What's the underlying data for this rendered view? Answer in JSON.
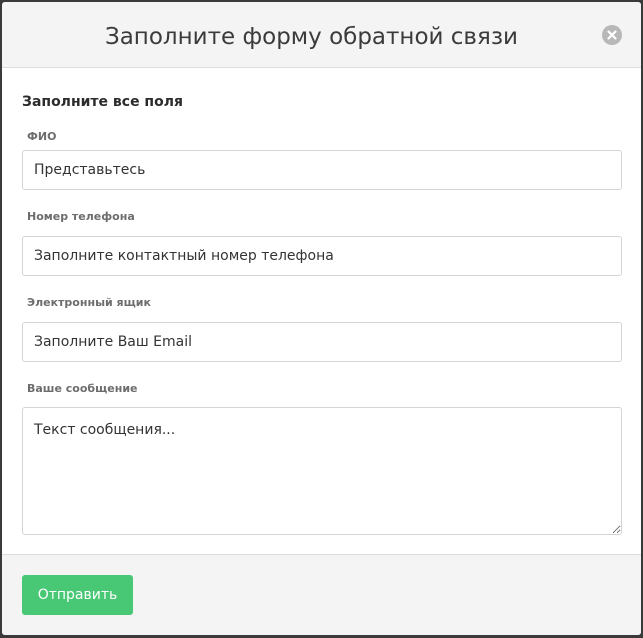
{
  "modal": {
    "title": "Заполните форму обратной связи",
    "close_icon": "close-icon"
  },
  "form": {
    "heading": "Заполните все поля",
    "fields": [
      {
        "label": "ФИО",
        "placeholder": "Представьтесь",
        "value": ""
      },
      {
        "label": "Номер телефона",
        "placeholder": "Заполните контактный номер телефона",
        "value": ""
      },
      {
        "label": "Электронный ящик",
        "placeholder": "Заполните Ваш Email",
        "value": ""
      },
      {
        "label": "Ваше сообщение",
        "placeholder": "Текст сообщения...",
        "value": ""
      }
    ]
  },
  "footer": {
    "submit_label": "Отправить"
  },
  "colors": {
    "header_bg": "#f4f4f4",
    "submit_bg": "#48c774",
    "close_bg": "#b8b8b8"
  }
}
